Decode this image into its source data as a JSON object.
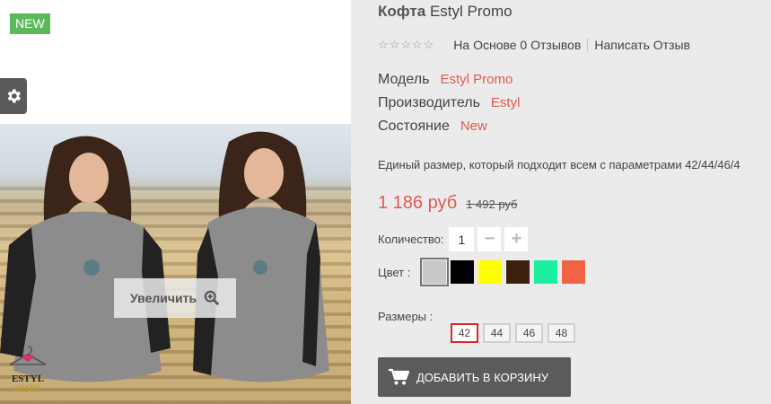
{
  "badge": {
    "new_label": "NEW"
  },
  "gallery": {
    "zoom_label": "Увеличить",
    "logo_text_top": "ESTYL",
    "logo_text_bottom": "SZARY"
  },
  "product": {
    "title_type": "Кофта",
    "title_name": "Estyl Promo",
    "rating": {
      "stars": 0,
      "max": 5,
      "reviews_text": "На Основе 0 Отзывов",
      "write_review": "Написать Отзыв"
    },
    "specs": [
      {
        "label": "Модель",
        "value": "Estyl Promo"
      },
      {
        "label": "Производитель",
        "value": "Estyl"
      },
      {
        "label": "Состояние",
        "value": "New"
      }
    ],
    "description": "Единый размер, который подходит всем с параметрами 42/44/46/4",
    "price": "1 186 руб",
    "old_price": "1 492 руб",
    "quantity": {
      "label": "Количество:",
      "value": "1",
      "minus": "−",
      "plus": "+"
    },
    "colors": {
      "label": "Цвет :",
      "selected_index": 0,
      "swatches": [
        "#c9c9c9",
        "#000000",
        "#ffff00",
        "#3d1f0e",
        "#1af0a0",
        "#f26244"
      ]
    },
    "sizes": {
      "label": "Размеры :",
      "selected": "42",
      "options": [
        "42",
        "44",
        "46",
        "48"
      ]
    },
    "add_to_cart": "ДОБАВИТЬ В КОРЗИНУ"
  }
}
